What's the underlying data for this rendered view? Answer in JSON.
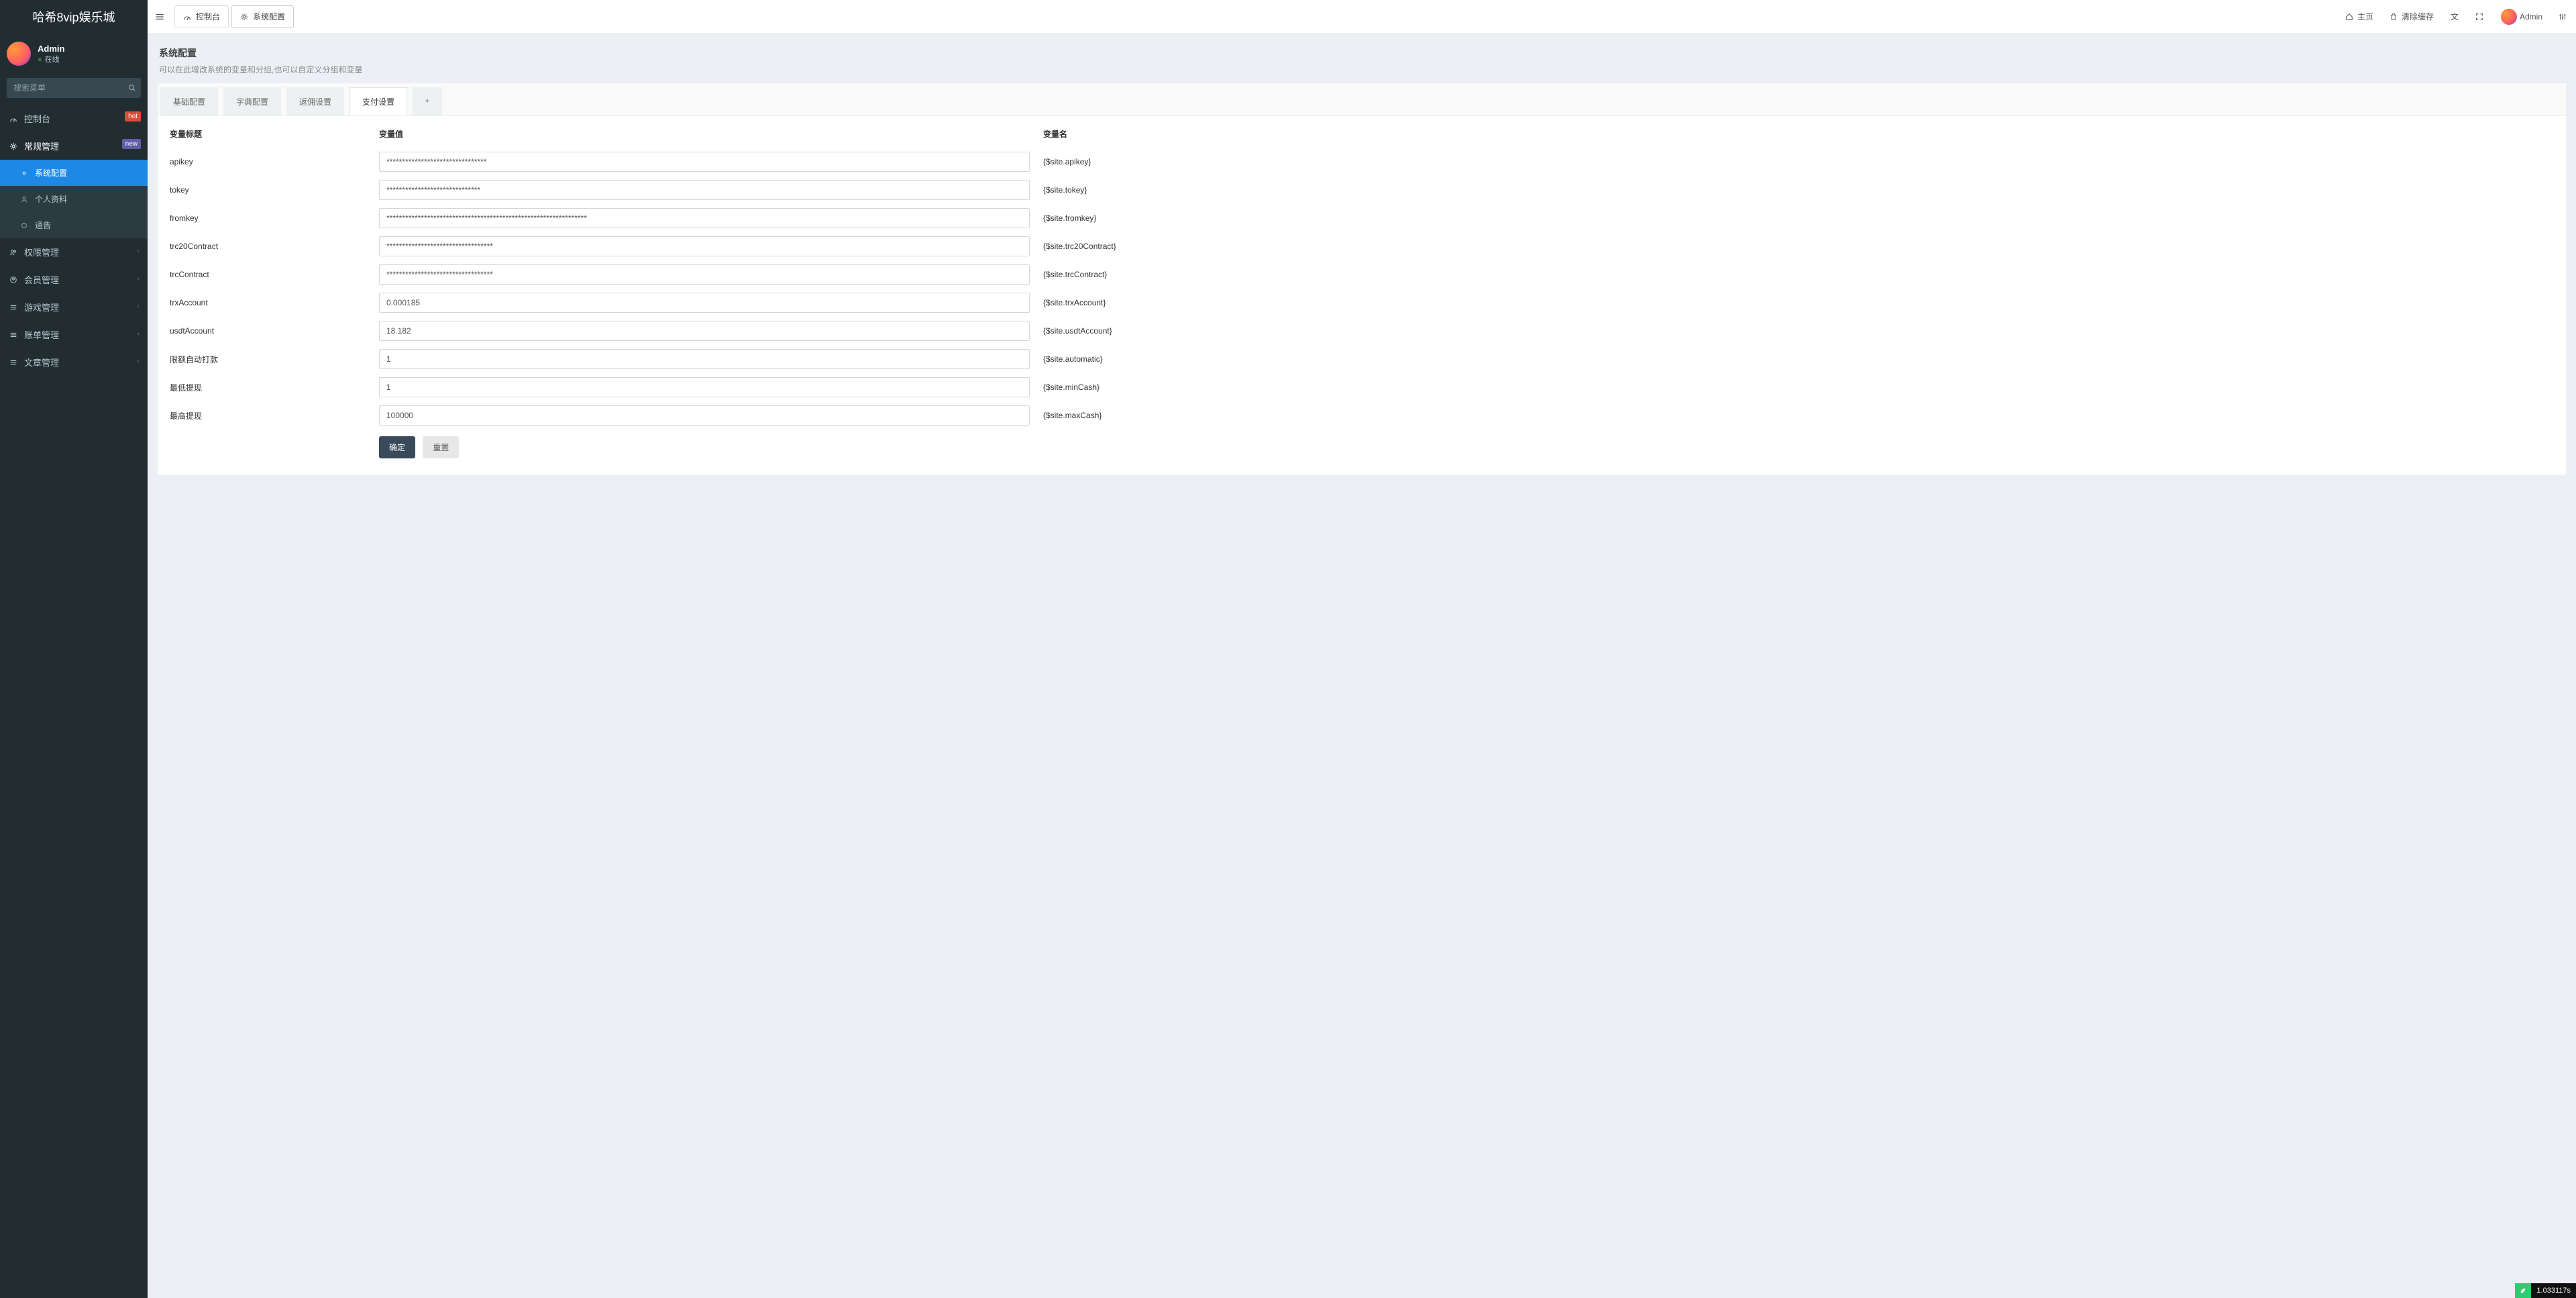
{
  "brand": "哈希8vip娱乐城",
  "header": {
    "toggle_title": "折叠菜单",
    "tab_console": "控制台",
    "tab_sysconfig": "系统配置",
    "home": "主页",
    "clear_cache": "清除缓存",
    "lang_title": "语言",
    "fullscreen_title": "全屏",
    "user": "Admin",
    "settings_title": "设置"
  },
  "sidebar": {
    "user_name": "Admin",
    "user_status": "在线",
    "search_placeholder": "搜索菜单",
    "items": {
      "console": {
        "label": "控制台",
        "badge": "hot"
      },
      "general": {
        "label": "常规管理",
        "badge": "new"
      },
      "sysconfig": {
        "label": "系统配置"
      },
      "profile": {
        "label": "个人资料"
      },
      "notice": {
        "label": "通告"
      },
      "perm": {
        "label": "权限管理"
      },
      "member": {
        "label": "会员管理"
      },
      "game": {
        "label": "游戏管理"
      },
      "bill": {
        "label": "账单管理"
      },
      "article": {
        "label": "文章管理"
      }
    }
  },
  "page": {
    "title": "系统配置",
    "desc": "可以在此增改系统的变量和分组,也可以自定义分组和变量"
  },
  "tabs": {
    "basic": "基础配置",
    "dict": "字典配置",
    "rebate": "返佣设置",
    "pay": "支付设置",
    "add": "+"
  },
  "table": {
    "head_label": "变量标题",
    "head_value": "变量值",
    "head_name": "变量名"
  },
  "rows": [
    {
      "label": "apikey",
      "value": "********************************",
      "name": "{$site.apikey}"
    },
    {
      "label": "tokey",
      "value": "******************************",
      "name": "{$site.tokey}"
    },
    {
      "label": "fromkey",
      "value": "****************************************************************",
      "name": "{$site.fromkey}"
    },
    {
      "label": "trc20Contract",
      "value": "**********************************",
      "name": "{$site.trc20Contract}"
    },
    {
      "label": "trcContract",
      "value": "**********************************",
      "name": "{$site.trcContract}"
    },
    {
      "label": "trxAccount",
      "value": "0.000185",
      "name": "{$site.trxAccount}"
    },
    {
      "label": "usdtAccount",
      "value": "18.182",
      "name": "{$site.usdtAccount}"
    },
    {
      "label": "限额自动打款",
      "value": "1",
      "name": "{$site.automatic}"
    },
    {
      "label": "最低提现",
      "value": "1",
      "name": "{$site.minCash}"
    },
    {
      "label": "最高提现",
      "value": "100000",
      "name": "{$site.maxCash}"
    }
  ],
  "actions": {
    "ok": "确定",
    "reset": "重置"
  },
  "perf": "1.033117s"
}
